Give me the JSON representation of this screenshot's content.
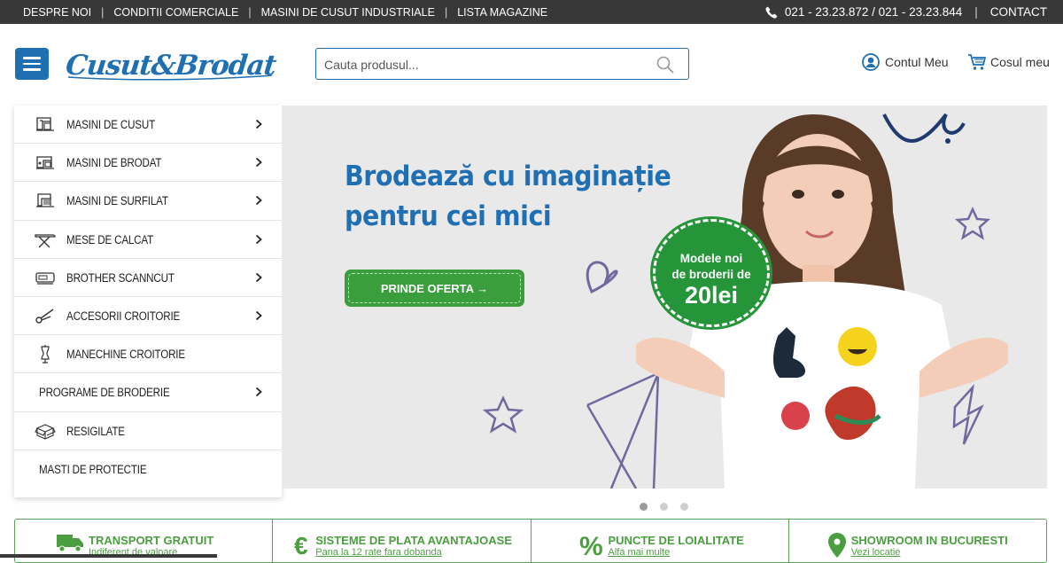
{
  "topbar": {
    "links": [
      "DESPRE NOI",
      "CONDITII COMERCIALE",
      "MASINI DE CUSUT INDUSTRIALE",
      "LISTA MAGAZINE"
    ],
    "phones": "021 - 23.23.872 / 021 - 23.23.844",
    "contact": "CONTACT"
  },
  "header": {
    "logo": "CusutBrodat",
    "search_placeholder": "Cauta produsul...",
    "account_label": "Contul Meu",
    "cart_label": "Cosul meu"
  },
  "sidebar": {
    "items": [
      {
        "label": "MASINI DE CUSUT",
        "icon": "sewing-machine-icon",
        "has_submenu": true
      },
      {
        "label": "MASINI DE BRODAT",
        "icon": "embroidery-machine-icon",
        "has_submenu": true
      },
      {
        "label": "MASINI DE SURFILAT",
        "icon": "overlock-machine-icon",
        "has_submenu": true
      },
      {
        "label": "MESE DE CALCAT",
        "icon": "ironing-board-icon",
        "has_submenu": true
      },
      {
        "label": "BROTHER SCANNCUT",
        "icon": "cutting-machine-icon",
        "has_submenu": true
      },
      {
        "label": "ACCESORII CROITORIE",
        "icon": "scissors-icon",
        "has_submenu": true
      },
      {
        "label": "MANECHINE CROITORIE",
        "icon": "mannequin-icon",
        "has_submenu": false
      },
      {
        "label": "PROGRAME DE BRODERIE",
        "icon": "",
        "has_submenu": true
      },
      {
        "label": "RESIGILATE",
        "icon": "open-box-icon",
        "has_submenu": false
      },
      {
        "label": "MASTI DE PROTECTIE",
        "icon": "",
        "has_submenu": false
      }
    ]
  },
  "hero": {
    "title_line1": "Brodează cu imaginație",
    "title_line2": "pentru cei mici",
    "cta_label": "PRINDE OFERTA →",
    "badge_line1": "Modele noi",
    "badge_line2": "de broderii de",
    "badge_price": "20lei",
    "slides": 3,
    "active_slide": 1
  },
  "features": [
    {
      "title": "TRANSPORT GRATUIT",
      "subtitle": "Indiferent de valoare",
      "icon": "truck-icon"
    },
    {
      "title": "SISTEME DE PLATA AVANTAJOASE",
      "subtitle": "Pana la 12 rate fara dobanda",
      "icon": "euro-icon"
    },
    {
      "title": "PUNCTE DE LOIALITATE",
      "subtitle": "Alfa mai multe",
      "icon": "percent-icon"
    },
    {
      "title": "SHOWROOM IN BUCURESTI",
      "subtitle": "Vezi locatie",
      "icon": "location-pin-icon"
    }
  ],
  "colors": {
    "topbar_bg": "#383838",
    "brand_blue": "#1f6fb2",
    "brand_green": "#3a9e3c"
  }
}
